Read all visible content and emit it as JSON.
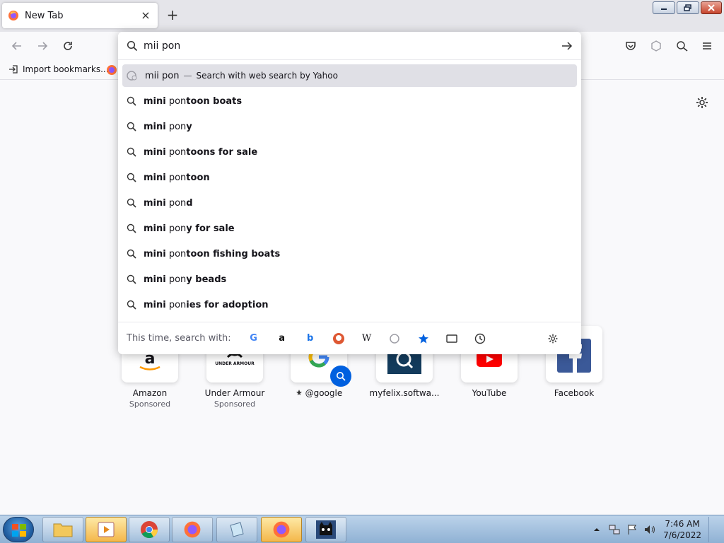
{
  "browser": {
    "tab_title": "New Tab",
    "tab_close": "×",
    "new_tab": "+"
  },
  "bookmarks": {
    "import_label": "Import bookmarks..."
  },
  "urlbar": {
    "value": "mii pon",
    "first_suggestion": {
      "query": "mii pon",
      "separator": "—",
      "hint": "Search with web search by Yahoo"
    },
    "suggestions": [
      {
        "bold1": "mini",
        "plain": " pon",
        "bold2": "toon boats"
      },
      {
        "bold1": "mini",
        "plain": " pon",
        "bold2": "y"
      },
      {
        "bold1": "mini",
        "plain": " pon",
        "bold2": "toons for sale"
      },
      {
        "bold1": "mini",
        "plain": " pon",
        "bold2": "toon"
      },
      {
        "bold1": "mini",
        "plain": " pon",
        "bold2": "d"
      },
      {
        "bold1": "mini",
        "plain": " pon",
        "bold2": "y for sale"
      },
      {
        "bold1": "mini",
        "plain": " pon",
        "bold2": "toon fishing boats"
      },
      {
        "bold1": "mini",
        "plain": " pon",
        "bold2": "y beads"
      },
      {
        "bold1": "mini",
        "plain": " pon",
        "bold2": "ies for adoption"
      }
    ],
    "search_with_label": "This time, search with:",
    "engines": [
      "G",
      "a",
      "b",
      "D",
      "W",
      "Y",
      "bookmark",
      "tab",
      "history"
    ]
  },
  "tiles": [
    {
      "label": "Amazon",
      "sub": "Sponsored"
    },
    {
      "label": "Under Armour",
      "sub": "Sponsored"
    },
    {
      "label": "@google",
      "sub": ""
    },
    {
      "label": "myfelix.softwa...",
      "sub": ""
    },
    {
      "label": "YouTube",
      "sub": ""
    },
    {
      "label": "Facebook",
      "sub": ""
    }
  ],
  "tile_logo_text": {
    "under_armour": "UNDER ARMOUR"
  },
  "taskbar": {
    "time": "7:46 AM",
    "date": "7/6/2022"
  },
  "colors": {
    "accent": "#0060df",
    "highlight": "#e0e0e6"
  }
}
